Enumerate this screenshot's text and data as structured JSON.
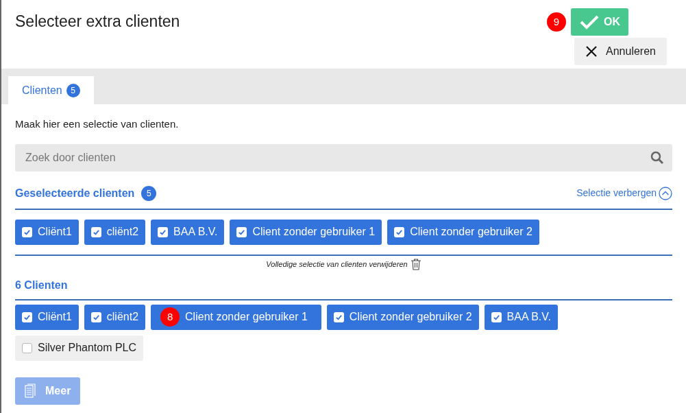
{
  "dialog": {
    "title": "Selecteer extra clienten"
  },
  "ok_button": {
    "label": "OK",
    "marker": "9"
  },
  "cancel_button": {
    "label": "Annuleren"
  },
  "tabs": [
    {
      "label": "Clienten",
      "count": "5",
      "selected": true
    }
  ],
  "intro": "Maak hier een selectie van clienten.",
  "search": {
    "placeholder": "Zoek door clienten"
  },
  "selected_section": {
    "title": "Geselecteerde clienten",
    "count": "5",
    "toggle_label": "Selectie verbergen",
    "items": [
      {
        "label": "Cliënt1",
        "checked": true
      },
      {
        "label": "cliënt2",
        "checked": true
      },
      {
        "label": "BAA B.V.",
        "checked": true
      },
      {
        "label": "Client zonder gebruiker 1",
        "checked": true
      },
      {
        "label": "Client zonder gebruiker 2",
        "checked": true
      }
    ],
    "clear_label": "Volledige selectie van clienten verwijderen"
  },
  "all_section": {
    "title": "6 Clienten",
    "items": [
      {
        "label": "Cliënt1",
        "checked": true
      },
      {
        "label": "cliënt2",
        "checked": true
      },
      {
        "label": "Client zonder gebruiker 1",
        "checked": true,
        "marker": "8"
      },
      {
        "label": "Client zonder gebruiker 2",
        "checked": true
      },
      {
        "label": "BAA B.V.",
        "checked": true
      },
      {
        "label": "Silver Phantom PLC",
        "checked": false
      }
    ]
  },
  "more_button": {
    "label": "Meer",
    "disabled": true
  }
}
